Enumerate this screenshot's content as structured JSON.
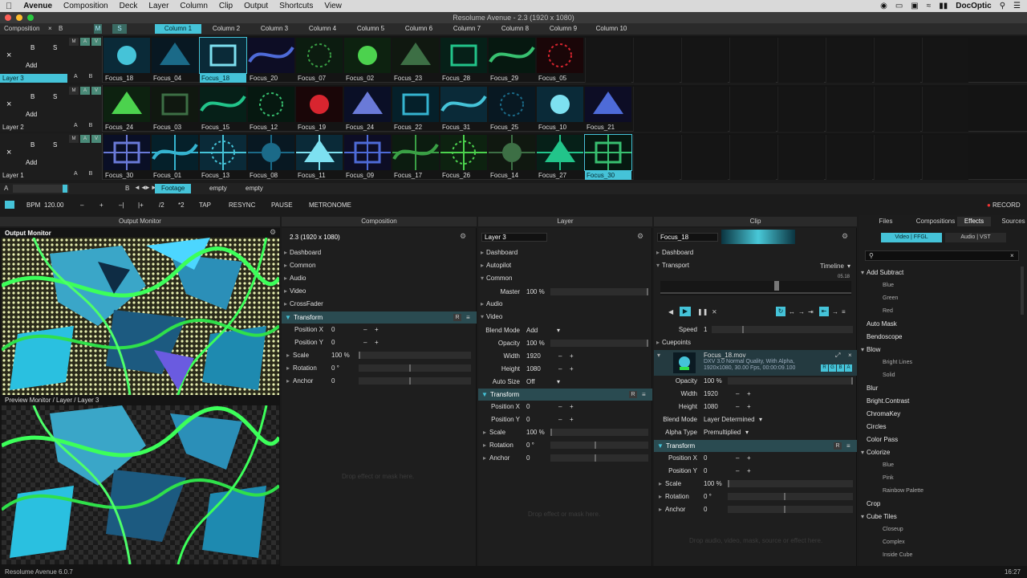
{
  "menubar": {
    "apple": "",
    "app_name": "Avenue",
    "items": [
      "Composition",
      "Deck",
      "Layer",
      "Column",
      "Clip",
      "Output",
      "Shortcuts",
      "View"
    ],
    "user": "DocOptic"
  },
  "window_title": "Resolume Avenue - 2.3 (1920 x 1080)",
  "column_header": {
    "composition_label": "Composition",
    "x": "×",
    "b": "B",
    "m": "M",
    "s": "S",
    "columns": [
      "Column 1",
      "Column 2",
      "Column 3",
      "Column 4",
      "Column 5",
      "Column 6",
      "Column 7",
      "Column 8",
      "Column 9",
      "Column 10"
    ],
    "selected_column": 0
  },
  "layers": [
    {
      "name": "Layer 3",
      "selected": true,
      "x": "×",
      "b": "B",
      "s": "S",
      "add": "Add",
      "mav": [
        "M",
        "A",
        "V"
      ],
      "ab": [
        "A",
        "B"
      ],
      "clips": [
        "Focus_18",
        "Focus_04",
        "Focus_18",
        "Focus_20",
        "Focus_07",
        "Focus_02",
        "Focus_23",
        "Focus_28",
        "Focus_29",
        "Focus_05"
      ],
      "selected_clip": 2
    },
    {
      "name": "Layer 2",
      "selected": false,
      "x": "×",
      "b": "B",
      "s": "S",
      "add": "Add",
      "mav": [
        "M",
        "A",
        "V"
      ],
      "ab": [
        "A",
        "B"
      ],
      "clips": [
        "Focus_24",
        "Focus_03",
        "Focus_15",
        "Focus_12",
        "Focus_19",
        "Focus_24",
        "Focus_22",
        "Focus_31",
        "Focus_25",
        "Focus_10",
        "Focus_21"
      ],
      "selected_clip": -1
    },
    {
      "name": "Layer 1",
      "selected": false,
      "x": "×",
      "b": "B",
      "s": "S",
      "add": "Add",
      "mav": [
        "M",
        "A",
        "V"
      ],
      "ab": [
        "A",
        "B"
      ],
      "clips": [
        "Focus_30",
        "Focus_01",
        "Focus_13",
        "Focus_08",
        "Focus_11",
        "Focus_09",
        "Focus_17",
        "Focus_26",
        "Focus_14",
        "Focus_27",
        "Focus_30"
      ],
      "selected_clip": 10
    }
  ],
  "deckbar": {
    "a": "A",
    "b": "B",
    "decks": [
      "Footage",
      "empty",
      "empty"
    ],
    "selected_deck": 0
  },
  "bpmbar": {
    "bpm_label": "BPM",
    "bpm_value": "120.00",
    "minus": "–",
    "plus": "+",
    "prev": "–|",
    "next": "|+",
    "half": "/2",
    "double": "*2",
    "tap": "TAP",
    "resync": "RESYNC",
    "pause": "PAUSE",
    "metronome": "METRONOME",
    "record": "RECORD"
  },
  "panel_headers": {
    "output": "Output Monitor",
    "composition": "Composition",
    "layer": "Layer",
    "clip": "Clip"
  },
  "output_monitor": {
    "title": "Output Monitor",
    "preview_title": "Preview Monitor / Layer / Layer 3"
  },
  "composition_panel": {
    "title": "2.3 (1920 x 1080)",
    "sections": [
      "Dashboard",
      "Common",
      "Audio",
      "Video",
      "CrossFader",
      "Transform"
    ],
    "r": "R",
    "params": [
      {
        "label": "Position X",
        "value": "0"
      },
      {
        "label": "Position Y",
        "value": "0"
      },
      {
        "label": "Scale",
        "value": "100 %"
      },
      {
        "label": "Rotation",
        "value": "0 °"
      },
      {
        "label": "Anchor",
        "value": "0"
      }
    ],
    "drop_hint": "Drop effect or mask here."
  },
  "layer_panel": {
    "title": "Layer 3",
    "sections": [
      "Dashboard",
      "Autopilot",
      "Common"
    ],
    "master_label": "Master",
    "master_value": "100 %",
    "audio": "Audio",
    "video": "Video",
    "blend_label": "Blend Mode",
    "blend_value": "Add",
    "opacity_label": "Opacity",
    "opacity_value": "100 %",
    "width_label": "Width",
    "width_value": "1920",
    "height_label": "Height",
    "height_value": "1080",
    "autosize_label": "Auto Size",
    "autosize_value": "Off",
    "transform": "Transform",
    "r": "R",
    "params": [
      {
        "label": "Position X",
        "value": "0"
      },
      {
        "label": "Position Y",
        "value": "0"
      },
      {
        "label": "Scale",
        "value": "100 %"
      },
      {
        "label": "Rotation",
        "value": "0 °"
      },
      {
        "label": "Anchor",
        "value": "0"
      }
    ],
    "drop_hint": "Drop effect or mask here."
  },
  "clip_panel": {
    "title": "Focus_18",
    "dashboard": "Dashboard",
    "transport": "Transport",
    "timeline": "Timeline",
    "time": "05.18",
    "speed_label": "Speed",
    "speed_value": "1",
    "cuepoints": "Cuepoints",
    "file_name": "Focus_18.mov",
    "file_info1": "DXV 3.0 Normal Quality, With Alpha,",
    "file_info2": "1920x1080, 30.00 Fps, 00:00:09.100",
    "rgba": [
      "R",
      "G",
      "B",
      "A"
    ],
    "opacity_label": "Opacity",
    "opacity_value": "100 %",
    "width_label": "Width",
    "width_value": "1920",
    "height_label": "Height",
    "height_value": "1080",
    "blend_label": "Blend Mode",
    "blend_value": "Layer Determined",
    "alpha_label": "Alpha Type",
    "alpha_value": "Premultiplied",
    "transform": "Transform",
    "r": "R",
    "params": [
      {
        "label": "Position X",
        "value": "0"
      },
      {
        "label": "Position Y",
        "value": "0"
      },
      {
        "label": "Scale",
        "value": "100 %"
      },
      {
        "label": "Rotation",
        "value": "0 °"
      },
      {
        "label": "Anchor",
        "value": "0"
      }
    ],
    "drop_hint": "Drop audio, video, mask, source or effect here."
  },
  "browser": {
    "tabs": [
      "Files",
      "Compositions",
      "Effects",
      "Sources"
    ],
    "selected_tab": 2,
    "subtabs": [
      "Video | FFGL",
      "Audio | VST"
    ],
    "selected_subtab": 0,
    "items": [
      {
        "name": "Add Subtract",
        "group": true
      },
      {
        "name": "Blue",
        "sub": true
      },
      {
        "name": "Green",
        "sub": true
      },
      {
        "name": "Red",
        "sub": true
      },
      {
        "name": "Auto Mask"
      },
      {
        "name": "Bendoscope"
      },
      {
        "name": "Blow",
        "group": true
      },
      {
        "name": "Bright Lines",
        "sub": true
      },
      {
        "name": "Solid",
        "sub": true
      },
      {
        "name": "Blur"
      },
      {
        "name": "Bright.Contrast"
      },
      {
        "name": "ChromaKey"
      },
      {
        "name": "Circles"
      },
      {
        "name": "Color Pass"
      },
      {
        "name": "Colorize",
        "group": true
      },
      {
        "name": "Blue",
        "sub": true
      },
      {
        "name": "Pink",
        "sub": true
      },
      {
        "name": "Rainbow Palette",
        "sub": true
      },
      {
        "name": "Crop"
      },
      {
        "name": "Cube Tiles",
        "group": true
      },
      {
        "name": "Closeup",
        "sub": true
      },
      {
        "name": "Complex",
        "sub": true
      },
      {
        "name": "Inside Cube",
        "sub": true
      }
    ]
  },
  "statusbar": {
    "version": "Resolume Avenue 6.0.7",
    "clock": "16:27"
  },
  "colors": {
    "accent": "#45c3d8",
    "background": "#1b1b1b",
    "panel": "#1e1e1e",
    "transform_hl": "#2a4b51"
  }
}
